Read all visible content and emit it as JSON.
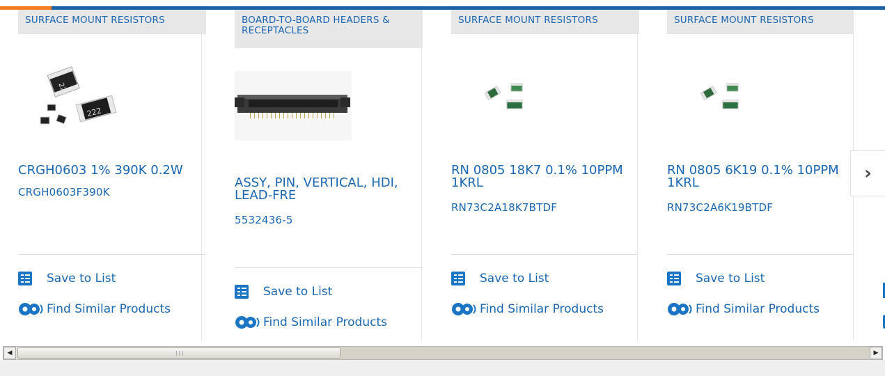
{
  "colors": {
    "accent_orange": "#f47b20",
    "brand_blue": "#1b63a9",
    "link_blue": "#1a66b2"
  },
  "products": [
    {
      "category": "SURFACE MOUNT RESISTORS",
      "title": "CRGH0603 1% 390K 0.2W",
      "part_number": "CRGH0603F390K",
      "image": "smd-resistor-chips-image",
      "save_label": "Save to List",
      "similar_label": "Find Similar Products"
    },
    {
      "category": "BOARD-TO-BOARD HEADERS & RECEPTACLES",
      "title": "ASSY, PIN, VERTICAL, HDI, LEAD-FRE",
      "part_number": "5532436-5",
      "image": "board-connector-image",
      "save_label": "Save to List",
      "similar_label": "Find Similar Products"
    },
    {
      "category": "SURFACE MOUNT RESISTORS",
      "title": "RN 0805 18K7 0.1% 10PPM 1KRL",
      "part_number": "RN73C2A18K7BTDF",
      "image": "thin-film-resistor-image",
      "save_label": "Save to List",
      "similar_label": "Find Similar Products"
    },
    {
      "category": "SURFACE MOUNT RESISTORS",
      "title": "RN 0805 6K19 0.1% 10PPM 1KRL",
      "part_number": "RN73C2A6K19BTDF",
      "image": "thin-film-resistor-image",
      "save_label": "Save to List",
      "similar_label": "Find Similar Products"
    }
  ],
  "next_button": {
    "icon": "chevron-right-icon",
    "glyph": "›"
  },
  "scrollbar": {
    "left_arrow": "◀",
    "right_arrow": "▶"
  }
}
